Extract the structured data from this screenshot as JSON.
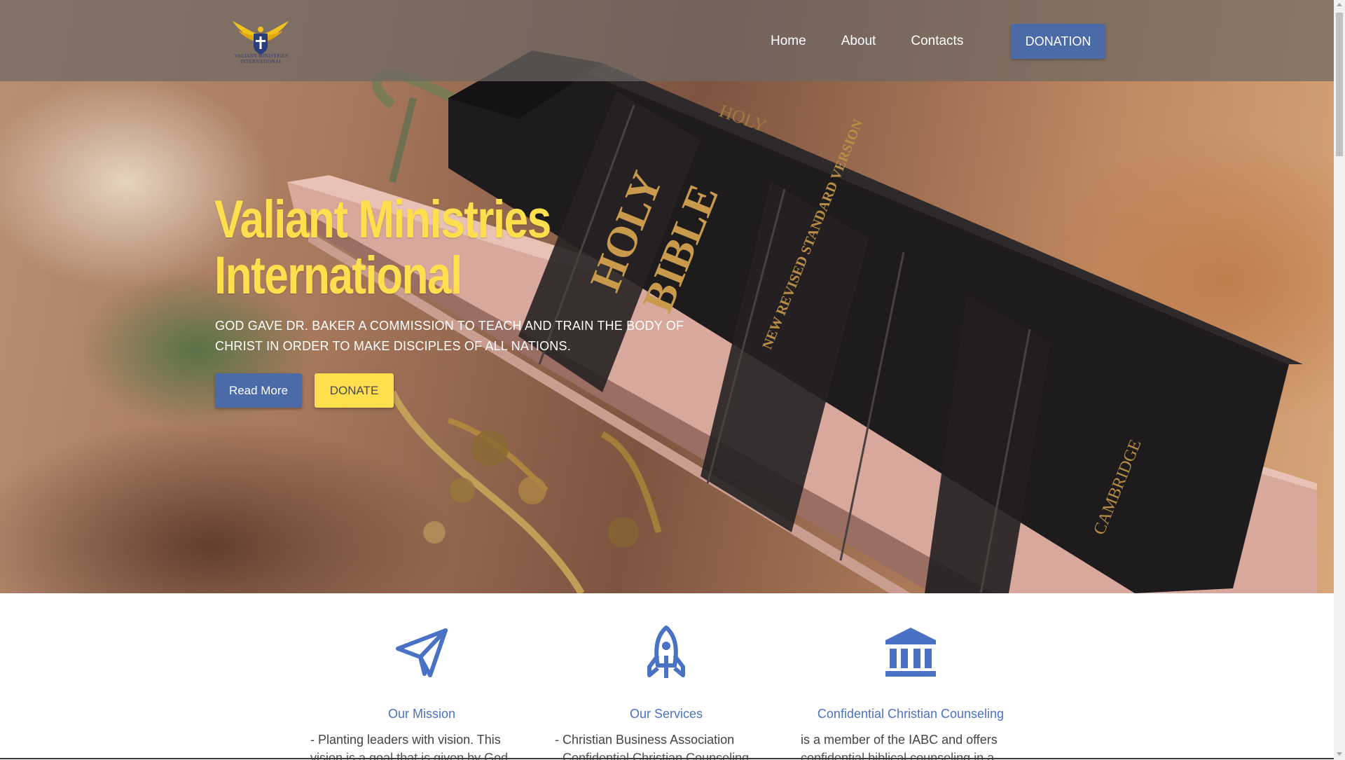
{
  "header": {
    "logo_text": "VALIANT MINISTRIES INTERNATIONAL",
    "nav": [
      {
        "label": "Home"
      },
      {
        "label": "About"
      },
      {
        "label": "Contacts"
      }
    ],
    "donation_label": "DONATION"
  },
  "hero": {
    "title_line1": "Valiant Ministries",
    "title_line2": "International",
    "subtitle": "God gave Dr. Baker a commission to teach and train the body of Christ in order to make disciples of all nations.",
    "read_more_label": "Read More",
    "donate_label": "DONATE",
    "background_text": {
      "spine_title_1": "HOLY",
      "spine_title_2": "BIBLE",
      "spine_version": "NEW REVISED STANDARD VERSION",
      "spine_publisher": "CAMBRIDGE"
    }
  },
  "features": [
    {
      "icon": "paper-plane-icon",
      "title": "Our Mission",
      "text": "- Planting leaders with vision. This",
      "text_line2": "vision is a goal that is given by God"
    },
    {
      "icon": "rocket-icon",
      "title": "Our Services",
      "text": "- Christian Business Association",
      "text_line2": "- Confidential Christian Counseling"
    },
    {
      "icon": "bank-icon",
      "title": "Confidential Christian Counseling",
      "text": "is a member of the IABC and offers",
      "text_line2": "confidential biblical counseling in a"
    }
  ],
  "colors": {
    "accent_blue": "#4a6aa8",
    "accent_yellow": "#ffdf4d",
    "icon_blue": "#4a72c4"
  }
}
